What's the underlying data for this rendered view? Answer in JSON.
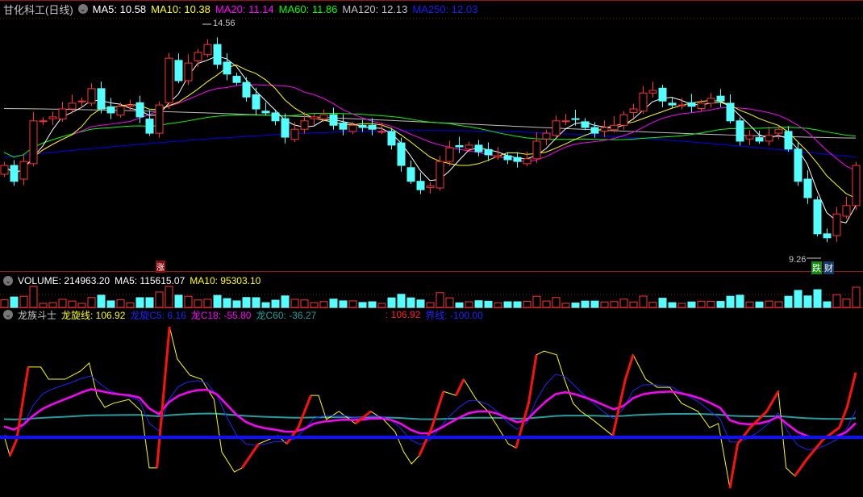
{
  "header": {
    "stock": "甘化科工(日线)",
    "ma5": "MA5: 10.58",
    "ma10": "MA10: 10.38",
    "ma20": "MA20: 11.14",
    "ma60": "MA60: 11.86",
    "ma120": "MA120: 12.13",
    "ma250": "MA250: 12.03"
  },
  "price_labels": {
    "high": "14.56",
    "low": "9.26",
    "up_marker": "涨",
    "down_marker": "跌",
    "finance_marker": "财"
  },
  "volume_header": {
    "volume": "VOLUME: 214963.20",
    "ma5": "MA5: 115615.07",
    "ma10": "MA10: 95303.10"
  },
  "indicator_header": {
    "name": "龙族斗士",
    "line": "龙旋线: 106.92",
    "c5": "龙旋C5: 6.16",
    "c18": "龙C18: -55.80",
    "c60": "龙C60: -36.27",
    "val": ": 106.92",
    "boundary": "界线: -100.00"
  },
  "colors": {
    "up": "#ff3232",
    "down": "#54ffff",
    "ma5": "#ffffff",
    "ma10": "#ffff00",
    "ma20": "#ff00ff",
    "ma60": "#00ff00",
    "ma120": "#c0c0c0",
    "ma250": "#0000ff",
    "c60": "#20a0a0"
  },
  "chart_data": {
    "type": "candlestick",
    "price_range": [
      9.0,
      14.8
    ],
    "closes": [
      11.36,
      11.0,
      11.45,
      12.37,
      12.37,
      12.46,
      12.64,
      12.77,
      12.82,
      13.1,
      12.64,
      12.55,
      12.7,
      12.73,
      12.46,
      12.09,
      12.73,
      13.79,
      13.28,
      13.68,
      13.92,
      14.1,
      13.65,
      13.43,
      13.24,
      12.91,
      12.64,
      12.55,
      12.37,
      12.0,
      12.18,
      12.37,
      12.46,
      12.51,
      12.27,
      12.18,
      12.27,
      12.22,
      12.18,
      12.13,
      11.82,
      11.36,
      11.0,
      10.81,
      10.9,
      11.45,
      11.76,
      11.78,
      11.82,
      11.67,
      11.6,
      11.58,
      11.49,
      11.45,
      11.51,
      11.91,
      12.09,
      12.37,
      12.37,
      12.4,
      12.22,
      12.09,
      12.22,
      12.27,
      12.51,
      12.64,
      13.0,
      13.06,
      12.82,
      12.73,
      12.73,
      12.7,
      12.77,
      12.88,
      12.82,
      12.37,
      11.91,
      12.04,
      11.91,
      12.04,
      12.18,
      11.73,
      11.0,
      10.63,
      9.81,
      9.72,
      10.26,
      10.45,
      11.36
    ],
    "indicator": {
      "range": [
        -280,
        260
      ],
      "boundary": -100,
      "line": [
        [
          0,
          -95
        ],
        [
          0.6,
          -159
        ],
        [
          1.3,
          -108
        ],
        [
          2.5,
          125
        ],
        [
          3.8,
          125
        ],
        [
          4.6,
          86
        ],
        [
          6.3,
          86
        ],
        [
          7.9,
          112
        ],
        [
          8.8,
          138
        ],
        [
          9.6,
          34
        ],
        [
          10.4,
          -4
        ],
        [
          11.3,
          9
        ],
        [
          12.9,
          21
        ],
        [
          14.2,
          -17
        ],
        [
          15,
          -198
        ],
        [
          15.8,
          -198
        ],
        [
          17.1,
          254
        ],
        [
          17.9,
          151
        ],
        [
          19.2,
          99
        ],
        [
          20.4,
          86
        ],
        [
          21.7,
          21
        ],
        [
          22.5,
          -147
        ],
        [
          23.8,
          -211
        ],
        [
          24.6,
          -198
        ],
        [
          26.3,
          -121
        ],
        [
          28.3,
          -95
        ],
        [
          29.2,
          -121
        ],
        [
          30.4,
          -69
        ],
        [
          31.7,
          34
        ],
        [
          32.5,
          34
        ],
        [
          33.3,
          -43
        ],
        [
          34.6,
          -17
        ],
        [
          36.3,
          -56
        ],
        [
          37.9,
          -17
        ],
        [
          39.2,
          -43
        ],
        [
          40.4,
          -82
        ],
        [
          41.3,
          -147
        ],
        [
          42.1,
          -185
        ],
        [
          42.9,
          -159
        ],
        [
          44.2,
          -69
        ],
        [
          45.4,
          47
        ],
        [
          46.7,
          34
        ],
        [
          47.5,
          86
        ],
        [
          48.8,
          21
        ],
        [
          50,
          -17
        ],
        [
          50.8,
          -56
        ],
        [
          52.1,
          -121
        ],
        [
          52.9,
          -134
        ],
        [
          54.2,
          9
        ],
        [
          55,
          164
        ],
        [
          55.8,
          176
        ],
        [
          57.1,
          164
        ],
        [
          57.9,
          86
        ],
        [
          58.8,
          9
        ],
        [
          59.6,
          -17
        ],
        [
          60.8,
          -43
        ],
        [
          62.9,
          -95
        ],
        [
          64.2,
          86
        ],
        [
          65,
          164
        ],
        [
          66.3,
          86
        ],
        [
          67.5,
          60
        ],
        [
          68.8,
          60
        ],
        [
          70,
          9
        ],
        [
          71.7,
          -17
        ],
        [
          72.9,
          -69
        ],
        [
          73.8,
          -56
        ],
        [
          75,
          -263
        ],
        [
          75.8,
          -121
        ],
        [
          77.1,
          -69
        ],
        [
          78.8,
          -17
        ],
        [
          80,
          47
        ],
        [
          80.8,
          -198
        ],
        [
          81.7,
          -224
        ],
        [
          82.9,
          -172
        ],
        [
          84.6,
          -108
        ],
        [
          86.3,
          -69
        ],
        [
          87.1,
          -4
        ],
        [
          88,
          107
        ]
      ]
    }
  }
}
